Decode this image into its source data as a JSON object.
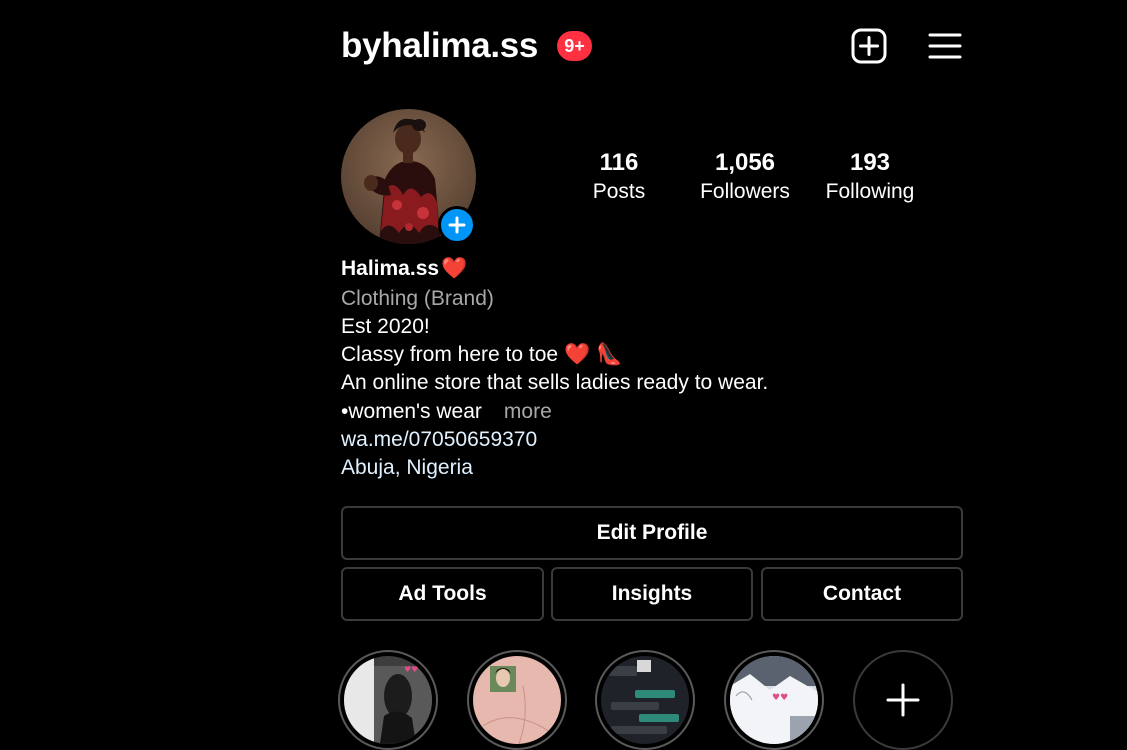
{
  "header": {
    "username": "byhalima.ss",
    "notification_badge": "9+",
    "new_post_icon": "plus-square-icon",
    "menu_icon": "hamburger-menu-icon"
  },
  "profile": {
    "avatar_icon": "profile-photo",
    "add_story_icon": "plus-icon"
  },
  "stats": {
    "posts": {
      "value": "116",
      "label": "Posts"
    },
    "followers": {
      "value": "1,056",
      "label": "Followers"
    },
    "following": {
      "value": "193",
      "label": "Following"
    }
  },
  "bio": {
    "display_name": "Halima.ss",
    "display_name_emoji": "❤️",
    "category": "Clothing (Brand)",
    "line1": "Est 2020!",
    "line2": "Classy from here to toe",
    "line2_emoji": "❤️ 👠",
    "line3": "An online store that sells ladies ready to wear.",
    "line4": "•women's wear",
    "more_label": "more",
    "link": "wa.me/07050659370",
    "location": "Abuja, Nigeria"
  },
  "buttons": {
    "edit_profile": "Edit Profile",
    "ad_tools": "Ad Tools",
    "insights": "Insights",
    "contact": "Contact"
  },
  "highlights": {
    "new_icon": "plus-icon"
  },
  "colors": {
    "background": "#000000",
    "badge_red": "#ff3040",
    "accent_blue": "#0095f6",
    "secondary_text": "#a8a8a8",
    "link_text": "#e0f1ff",
    "button_border": "#3a3a3a"
  }
}
